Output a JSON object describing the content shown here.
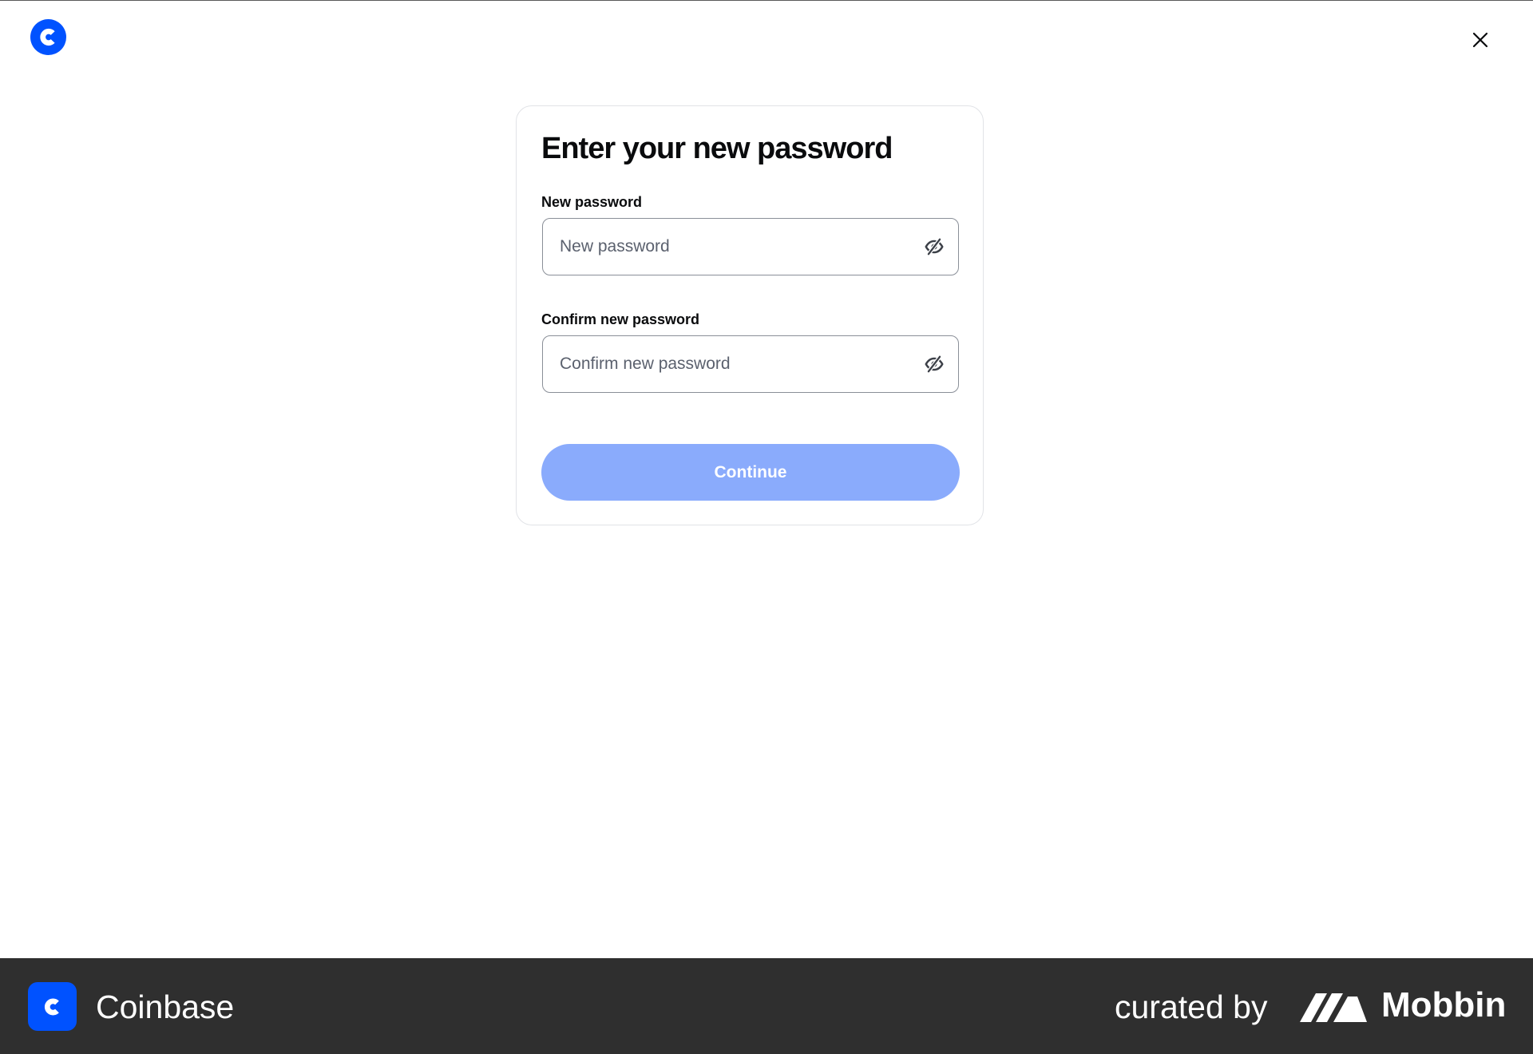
{
  "header": {
    "logo_icon": "coinbase-logo-icon",
    "close_icon": "close-icon"
  },
  "form": {
    "title": "Enter your new password",
    "new_password": {
      "label": "New password",
      "placeholder": "New password",
      "value": "",
      "toggle_icon": "eye-off-icon"
    },
    "confirm_password": {
      "label": "Confirm new password",
      "placeholder": "Confirm new password",
      "value": "",
      "toggle_icon": "eye-off-icon"
    },
    "continue_label": "Continue"
  },
  "footer": {
    "app_name": "Coinbase",
    "curated_by": "curated by",
    "brand_name": "Mobbin"
  },
  "colors": {
    "brand_blue": "#0052ff",
    "button_disabled": "#8aabfc",
    "footer_bg": "#2f2f2f",
    "text_primary": "#0a0b0d",
    "placeholder": "#5b616e",
    "input_border": "#8a8f98",
    "card_border": "#e1e3e7"
  }
}
